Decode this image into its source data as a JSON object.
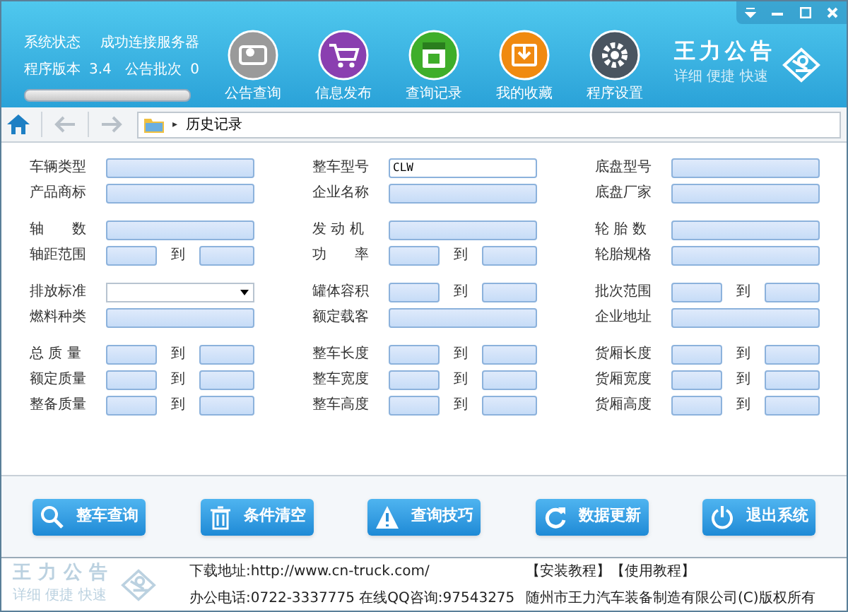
{
  "status": {
    "rows": [
      {
        "label": "系统状态",
        "right_label": "成功连接服务器"
      },
      {
        "label": "程序版本",
        "value": "3.4",
        "right_label": "公告批次",
        "right_value": "0"
      }
    ],
    "progress": {
      "level": 0
    }
  },
  "toolbar": [
    {
      "label": "公告查询",
      "color": "#9a9a9a",
      "kind": "card"
    },
    {
      "label": "信息发布",
      "color": "#8a3fb0",
      "kind": "cart"
    },
    {
      "label": "查询记录",
      "color": "#3fae2a",
      "kind": "calendar"
    },
    {
      "label": "我的收藏",
      "color": "#f08a10",
      "kind": "box"
    },
    {
      "label": "程序设置",
      "color": "#4a5560",
      "kind": "gear"
    }
  ],
  "brand": {
    "title": "王力公告",
    "slogan": "详细 便捷 快速"
  },
  "breadcrumb": {
    "separator": "▸",
    "current": "历史记录"
  },
  "form": {
    "sections": [
      [
        [
          {
            "label": "车辆类型",
            "kind": "text"
          },
          {
            "label": "整车型号",
            "kind": "text",
            "value": "CLW"
          },
          {
            "label": "底盘型号",
            "kind": "text"
          }
        ],
        [
          {
            "label": "产品商标",
            "kind": "text"
          },
          {
            "label": "企业名称",
            "kind": "text"
          },
          {
            "label": "底盘厂家",
            "kind": "text"
          }
        ]
      ],
      [
        [
          {
            "label": "轴　　数",
            "kind": "text"
          },
          {
            "label": "发 动 机",
            "kind": "text"
          },
          {
            "label": "轮 胎 数",
            "kind": "text"
          }
        ],
        [
          {
            "label": "轴距范围",
            "kind": "range",
            "to": "到"
          },
          {
            "label": "功　　率",
            "kind": "range",
            "to": "到"
          },
          {
            "label": "轮胎规格",
            "kind": "text"
          }
        ]
      ],
      [
        [
          {
            "label": "排放标准",
            "kind": "select"
          },
          {
            "label": "罐体容积",
            "kind": "range",
            "to": "到"
          },
          {
            "label": "批次范围",
            "kind": "range",
            "to": "到"
          }
        ],
        [
          {
            "label": "燃料种类",
            "kind": "text"
          },
          {
            "label": "额定载客",
            "kind": "text"
          },
          {
            "label": "企业地址",
            "kind": "text"
          }
        ]
      ],
      [
        [
          {
            "label": "总 质 量",
            "kind": "range",
            "to": "到"
          },
          {
            "label": "整车长度",
            "kind": "range",
            "to": "到"
          },
          {
            "label": "货厢长度",
            "kind": "range",
            "to": "到"
          }
        ],
        [
          {
            "label": "额定质量",
            "kind": "range",
            "to": "到"
          },
          {
            "label": "整车宽度",
            "kind": "range",
            "to": "到"
          },
          {
            "label": "货厢宽度",
            "kind": "range",
            "to": "到"
          }
        ],
        [
          {
            "label": "整备质量",
            "kind": "range",
            "to": "到"
          },
          {
            "label": "整车高度",
            "kind": "range",
            "to": "到"
          },
          {
            "label": "货厢高度",
            "kind": "range",
            "to": "到"
          }
        ]
      ]
    ]
  },
  "actions": [
    {
      "label": "整车查询",
      "kind": "search"
    },
    {
      "label": "条件清空",
      "kind": "trash"
    },
    {
      "label": "查询技巧",
      "kind": "warning"
    },
    {
      "label": "数据更新",
      "kind": "refresh"
    },
    {
      "label": "退出系统",
      "kind": "power"
    }
  ],
  "footer": {
    "brand_title": "王力公告",
    "brand_slogan": "详细 便捷 快速",
    "download": "下载地址:http://www.cn-truck.com/",
    "contact": "办公电话:0722-3337775 在线QQ咨询:97543275",
    "links": "【安装教程】【使用教程】",
    "copyright": "随州市王力汽车装备制造有限公司(C)版权所有"
  }
}
